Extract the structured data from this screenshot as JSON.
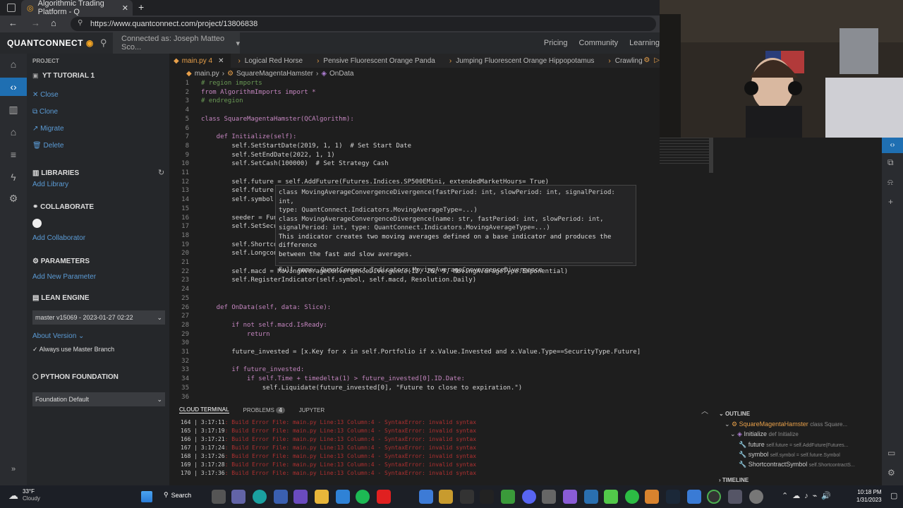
{
  "browser": {
    "tab_title": "Algorithmic Trading Platform - Q",
    "url": "https://www.quantconnect.com/project/13806838"
  },
  "header": {
    "logo": "QUANTCONNECT",
    "connected_as": "Connected as: Joseph Matteo Sco...",
    "nav": [
      "Pricing",
      "Community",
      "Learning"
    ]
  },
  "sidebar": {
    "project_label": "PROJECT",
    "project_name": "YT TUTORIAL 1",
    "actions": [
      "Close",
      "Clone",
      "Migrate",
      "Delete"
    ],
    "libraries": "LIBRARIES",
    "add_library": "Add Library",
    "collaborate": "COLLABORATE",
    "add_collaborator": "Add Collaborator",
    "parameters": "PARAMETERS",
    "add_parameter": "Add New Parameter",
    "lean_engine": "LEAN ENGINE",
    "lean_version": "master v15069 - 2023-01-27 02:22",
    "about_version": "About Version",
    "always_master": "Always use Master Branch",
    "python_foundation": "PYTHON FOUNDATION",
    "foundation_value": "Foundation Default"
  },
  "editor": {
    "tabs": [
      "main.py 4",
      "Logical Red Horse",
      "Pensive Fluorescent Orange Panda",
      "Jumping Fluorescent Orange Hippopotamus",
      "Crawling Mage"
    ],
    "breadcrumb": [
      "main.py",
      "SquareMagentaHamster",
      "OnData"
    ],
    "lines": [
      {
        "n": "1",
        "t": "# region imports"
      },
      {
        "n": "2",
        "t": "from AlgorithmImports import *"
      },
      {
        "n": "3",
        "t": "# endregion"
      },
      {
        "n": "4",
        "t": ""
      },
      {
        "n": "5",
        "t": "class SquareMagentaHamster(QCAlgorithm):"
      },
      {
        "n": "6",
        "t": ""
      },
      {
        "n": "7",
        "t": "    def Initialize(self):"
      },
      {
        "n": "8",
        "t": "        self.SetStartDate(2019, 1, 1)  # Set Start Date"
      },
      {
        "n": "9",
        "t": "        self.SetEndDate(2022, 1, 1)"
      },
      {
        "n": "10",
        "t": "        self.SetCash(100000)  # Set Strategy Cash"
      },
      {
        "n": "11",
        "t": ""
      },
      {
        "n": "12",
        "t": "        self.future = self.AddFuture(Futures.Indices.SP500EMini, extendedMarketHours= True)"
      },
      {
        "n": "13",
        "t": "        self.future."
      },
      {
        "n": "14",
        "t": "        self.symbol"
      },
      {
        "n": "15",
        "t": ""
      },
      {
        "n": "16",
        "t": "        seeder = Fun"
      },
      {
        "n": "17",
        "t": "        self.SetSecu"
      },
      {
        "n": "18",
        "t": ""
      },
      {
        "n": "19",
        "t": "        self.Shortco"
      },
      {
        "n": "20",
        "t": "        self.Longcon"
      },
      {
        "n": "21",
        "t": ""
      },
      {
        "n": "22",
        "t": "        self.macd = MovingAverageConvergenceDivergence(12, 26, 9, MovingAverageType.Exponential)"
      },
      {
        "n": "23",
        "t": "        self.RegisterIndicator(self.symbol, self.macd, Resolution.Daily)"
      },
      {
        "n": "24",
        "t": ""
      },
      {
        "n": "25",
        "t": ""
      },
      {
        "n": "26",
        "t": "    def OnData(self, data: Slice):"
      },
      {
        "n": "27",
        "t": ""
      },
      {
        "n": "28",
        "t": "        if not self.macd.IsReady:"
      },
      {
        "n": "29",
        "t": "            return"
      },
      {
        "n": "30",
        "t": ""
      },
      {
        "n": "31",
        "t": "        future_invested = [x.Key for x in self.Portfolio if x.Value.Invested and x.Value.Type==SecurityType.Future]"
      },
      {
        "n": "32",
        "t": ""
      },
      {
        "n": "33",
        "t": "        if future_invested:"
      },
      {
        "n": "34",
        "t": "            if self.Time + timedelta(1) > future_invested[0].ID.Date:"
      },
      {
        "n": "35",
        "t": "                self.Liquidate(future_invested[0], \"Future to close to expiration.\")"
      },
      {
        "n": "36",
        "t": ""
      }
    ],
    "hover": [
      "class MovingAverageConvergenceDivergence(fastPeriod: int, slowPeriod: int, signalPeriod: int,",
      "type: QuantConnect.Indicators.MovingAverageType=...)",
      "class MovingAverageConvergenceDivergence(name: str, fastPeriod: int, slowPeriod: int,",
      "signalPeriod: int, type: QuantConnect.Indicators.MovingAverageType=...)",
      "This indicator creates two moving averages defined on a base indicator and produces the",
      "difference",
      "between the fast and slow averages.",
      "Full name: QuantConnect.Indicators.MovingAverageConvergenceDivergence"
    ]
  },
  "terminal": {
    "tabs": [
      "CLOUD TERMINAL",
      "PROBLEMS",
      "JUPYTER"
    ],
    "problems_count": "4",
    "lines": [
      {
        "n": "164 | 3:17:11",
        "msg": ":  Build Error File: main.py Line:13 Column:4 - SyntaxError: invalid syntax"
      },
      {
        "n": "165 | 3:17:19",
        "msg": ":  Build Error File: main.py Line:13 Column:4 - SyntaxError: invalid syntax"
      },
      {
        "n": "166 | 3:17:21",
        "msg": ":  Build Error File: main.py Line:13 Column:4 - SyntaxError: invalid syntax"
      },
      {
        "n": "167 | 3:17:24",
        "msg": ":  Build Error File: main.py Line:13 Column:4 - SyntaxError: invalid syntax"
      },
      {
        "n": "168 | 3:17:26",
        "msg": ":  Build Error File: main.py Line:13 Column:4 - SyntaxError: invalid syntax"
      },
      {
        "n": "169 | 3:17:28",
        "msg": ":  Build Error File: main.py Line:13 Column:4 - SyntaxError: invalid syntax"
      },
      {
        "n": "170 | 3:17:36",
        "msg": ":  Build Error File: main.py Line:13 Column:4 - SyntaxError: invalid syntax"
      }
    ]
  },
  "outline": {
    "title": "OUTLINE",
    "class_name": "SquareMagentaHamster",
    "class_detail": "class Square...",
    "method": "Initialize",
    "method_detail": "def Initialize",
    "items": [
      {
        "name": "future",
        "detail": "self.future = self.AddFuture(Futures..."
      },
      {
        "name": "symbol",
        "detail": "self.symbol = self.future.Symbol"
      },
      {
        "name": "ShortcontractSymbol",
        "detail": "self.ShortcontractS..."
      }
    ],
    "timeline": "TIMELINE"
  },
  "taskbar": {
    "weather_temp": "33°F",
    "weather_desc": "Cloudy",
    "search": "Search",
    "time": "10:18 PM",
    "date": "1/31/2023"
  }
}
